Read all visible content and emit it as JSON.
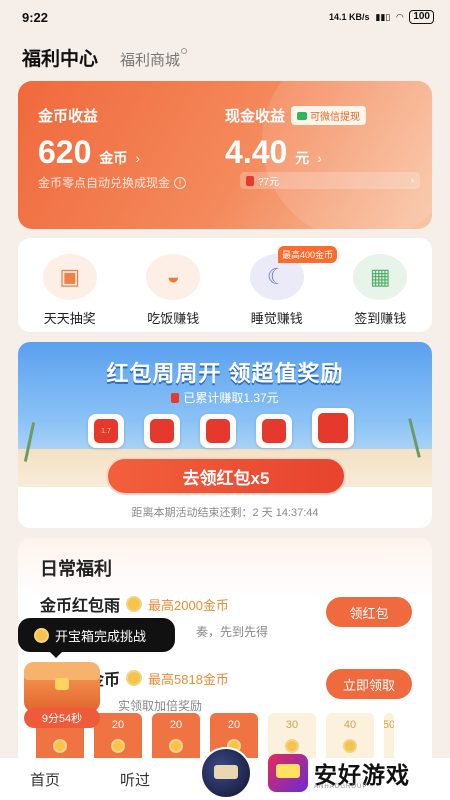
{
  "status_bar": {
    "time": "9:22",
    "net_speed": "14.1 KB/s",
    "battery": "100"
  },
  "header": {
    "title": "福利中心",
    "shop": "福利商城"
  },
  "earnings": {
    "coin_label": "金币收益",
    "coin_value": "620",
    "coin_unit": "金币",
    "cash_label": "现金收益",
    "cash_value": "4.40",
    "cash_unit": "元",
    "wechat_badge": "可微信提现",
    "note": "金币零点自动兑换成现金",
    "pill_text": "?7元"
  },
  "shortcuts": [
    {
      "label": "天天抽奖",
      "icon": "gift-box-icon"
    },
    {
      "label": "吃饭赚钱",
      "icon": "rice-bowl-icon"
    },
    {
      "label": "睡觉赚钱",
      "icon": "moon-icon"
    },
    {
      "label": "签到赚钱",
      "icon": "calendar-check-icon"
    }
  ],
  "sleep_badge": "最高400金币",
  "banner": {
    "title": "红包周周开  领超值奖励",
    "subtitle": "已累计赚取1.37元",
    "packet_first": "1.7",
    "button": "去领红包x5",
    "countdown": "距离本期活动结束还剩：2 天 14:37:44"
  },
  "daily": {
    "title": "日常福利",
    "tasks": [
      {
        "name": "金币红包雨",
        "reward": "最高2000金币",
        "desc": "奏，先到先得",
        "button": "领红包"
      },
      {
        "name": "听书赚金币",
        "reward": "最高5818金币",
        "desc": "实领取加倍奖励",
        "button": "立即领取"
      }
    ]
  },
  "tooltip": "开宝箱完成挑战",
  "chest_timer": "9分54秒",
  "coin_cells": [
    "20",
    "20",
    "20",
    "20",
    "30",
    "40",
    "50"
  ],
  "tabs": {
    "home": "首页",
    "listened": "听过"
  },
  "watermark": {
    "text": "安好游戏",
    "sub": "ANHAOGROUP"
  }
}
